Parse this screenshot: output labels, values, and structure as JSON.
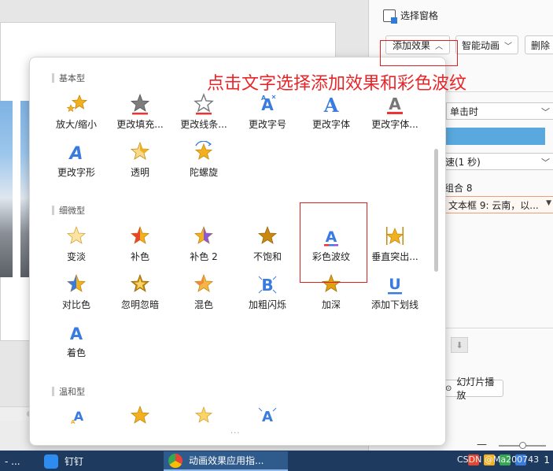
{
  "right_pane": {
    "selection_pane_label": "选择窗格",
    "add_effect_label": "添加效果",
    "smart_anim_label": "智能动画",
    "delete_label": "删除",
    "start_value": "单击时",
    "speed_value": "速(1 秒)",
    "group_item": "组合 8",
    "textbox_item": "文本框 9: 云南，以...",
    "slideshow_label": "幻灯片播放"
  },
  "annotation": {
    "text": "点击文字选择添加效果和彩色波纹",
    "color": "#e8262a"
  },
  "effect_panel": {
    "sections": [
      {
        "title": "基本型",
        "items": [
          {
            "label": "放大/缩小",
            "icon": "zoom-star"
          },
          {
            "label": "更改填充...",
            "icon": "fill-star"
          },
          {
            "label": "更改线条...",
            "icon": "line-star"
          },
          {
            "label": "更改字号",
            "icon": "fontsize-a"
          },
          {
            "label": "更改字体",
            "icon": "font-a"
          },
          {
            "label": "更改字体...",
            "icon": "fontcolor-a"
          },
          {
            "label": "更改字形",
            "icon": "fontstyle-a"
          },
          {
            "label": "透明",
            "icon": "transparent-star"
          },
          {
            "label": "陀螺旋",
            "icon": "spin-star"
          }
        ]
      },
      {
        "title": "细微型",
        "items": [
          {
            "label": "变淡",
            "icon": "fade-star"
          },
          {
            "label": "补色",
            "icon": "complement-star"
          },
          {
            "label": "补色 2",
            "icon": "complement2-star"
          },
          {
            "label": "不饱和",
            "icon": "desaturate-star"
          },
          {
            "label": "彩色波纹",
            "icon": "color-wave-a"
          },
          {
            "label": "垂直突出...",
            "icon": "vertical-star"
          },
          {
            "label": "对比色",
            "icon": "contrast-star"
          },
          {
            "label": "忽明忽暗",
            "icon": "flicker-star"
          },
          {
            "label": "混色",
            "icon": "blend-star"
          },
          {
            "label": "加粗闪烁",
            "icon": "bold-flash-b"
          },
          {
            "label": "加深",
            "icon": "darken-star"
          },
          {
            "label": "添加下划线",
            "icon": "underline-u"
          },
          {
            "label": "着色",
            "icon": "tint-a"
          }
        ]
      },
      {
        "title": "温和型",
        "items": []
      }
    ]
  },
  "taskbar": {
    "item1": "- ...",
    "item2": "钉钉",
    "item3": "动画效果应用指...",
    "watermark": "CSDN @Ma200743",
    "clock": "1"
  },
  "colors": {
    "star_gold": "#f2b01e",
    "accent_blue": "#3a7be0",
    "annotation_red": "#e02020"
  }
}
